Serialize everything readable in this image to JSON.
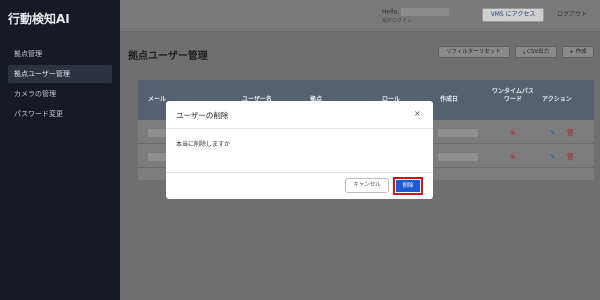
{
  "sidebar": {
    "brand": "行動検知AI",
    "items": [
      {
        "label": "拠点管理"
      },
      {
        "label": "拠点ユーザー管理"
      },
      {
        "label": "カメラの管理"
      },
      {
        "label": "パスワード変更"
      }
    ]
  },
  "topbar": {
    "greeting": "Hello,",
    "subtext": "最終ログイン",
    "vms_label": "VMS にアクセス",
    "logout_label": "ログアウト"
  },
  "page": {
    "title": "拠点ユーザー管理",
    "filter_reset": "フィルターリセット",
    "csv_export": "CSV出力",
    "create": "作成"
  },
  "table": {
    "columns": [
      "メール",
      "ユーザー名",
      "拠点",
      "ロール",
      "作成日",
      "ワンタイムパスワード",
      "アクション"
    ]
  },
  "modal": {
    "title": "ユーザーの削除",
    "close": "×",
    "message": "本当に削除しますか",
    "cancel_label": "キャンセル",
    "delete_label": "削除"
  },
  "colors": {
    "primary": "#1e5bd6",
    "highlight": "#d1141a",
    "sidebar_bg": "#141b26"
  }
}
